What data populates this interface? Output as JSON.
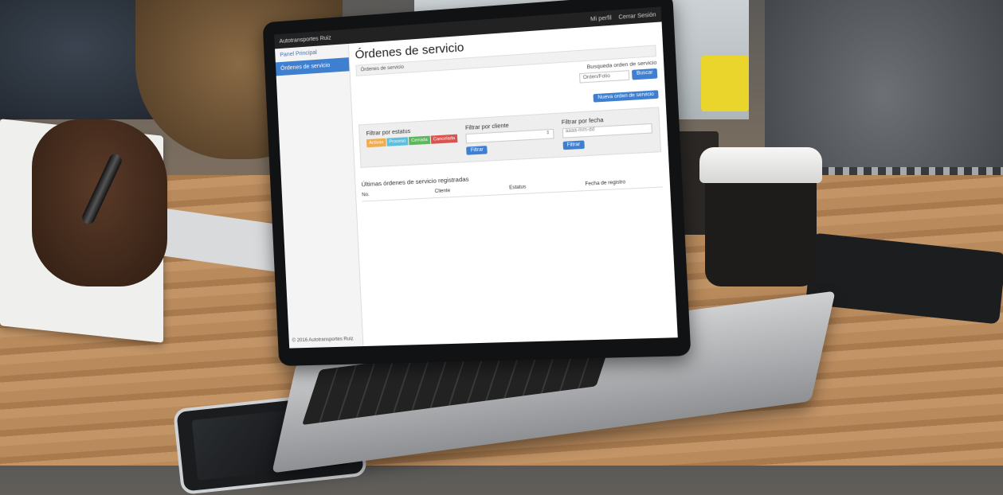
{
  "app": {
    "brand": "Autotransportes Ruiz",
    "user_menu": "Mi perfil",
    "logout": "Cerrar Sesión"
  },
  "sidebar": {
    "items": [
      {
        "label": "Panel Principal",
        "active": false
      },
      {
        "label": "Órdenes de servicio",
        "active": true
      }
    ],
    "footer": "© 2016 Autotransportes Ruiz"
  },
  "main": {
    "title": "Órdenes de servicio",
    "breadcrumb": "Órdenes de servicio",
    "search": {
      "label": "Busqueda orden de servicio",
      "placeholder": "Orden/Folio",
      "button": "Buscar"
    },
    "new_button": "Nueva orden de servicio",
    "filters": {
      "status": {
        "label": "Filtrar por estatus",
        "buttons": [
          {
            "label": "Activas",
            "color": "#f0ad4e"
          },
          {
            "label": "Proceso",
            "color": "#5bc0de"
          },
          {
            "label": "Cerrada",
            "color": "#5cb85c"
          },
          {
            "label": "Cancelada",
            "color": "#d9534f"
          }
        ]
      },
      "client": {
        "label": "Filtrar por cliente",
        "button": "Filtrar"
      },
      "date": {
        "label": "Filtrar por fecha",
        "placeholder": "aaaa-mm-dd",
        "button": "Filtrar"
      }
    },
    "recent": {
      "title": "Últimas órdenes de servicio registradas",
      "columns": [
        "No.",
        "Cliente",
        "Estatus",
        "Fecha de registro"
      ]
    }
  },
  "colors": {
    "primary": "#3f7fd0",
    "topbar": "#222222"
  }
}
